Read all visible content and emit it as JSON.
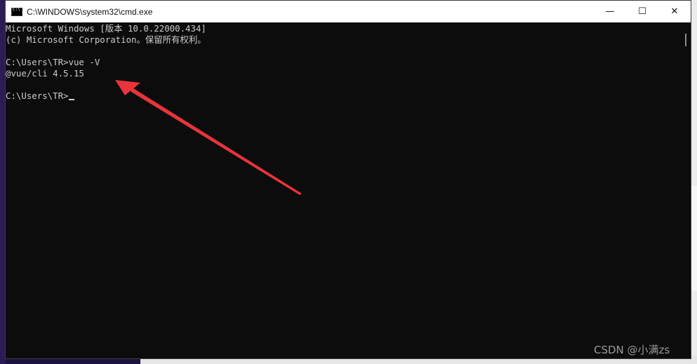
{
  "window": {
    "title": "C:\\WINDOWS\\system32\\cmd.exe",
    "controls": {
      "minimize": "—",
      "maximize": "☐",
      "close": "✕"
    }
  },
  "terminal": {
    "lines": [
      "Microsoft Windows [版本 10.0.22000.434]",
      "(c) Microsoft Corporation。保留所有权利。",
      "",
      "C:\\Users\\TR>vue -V",
      "@vue/cli 4.5.15",
      "",
      "C:\\Users\\TR>"
    ]
  },
  "annotation": {
    "arrow_color": "#e8343a"
  },
  "watermark": "CSDN @小满zs",
  "colors": {
    "terminal_bg": "#0c0c0c",
    "terminal_fg": "#cccccc",
    "titlebar_bg": "#ffffff"
  }
}
